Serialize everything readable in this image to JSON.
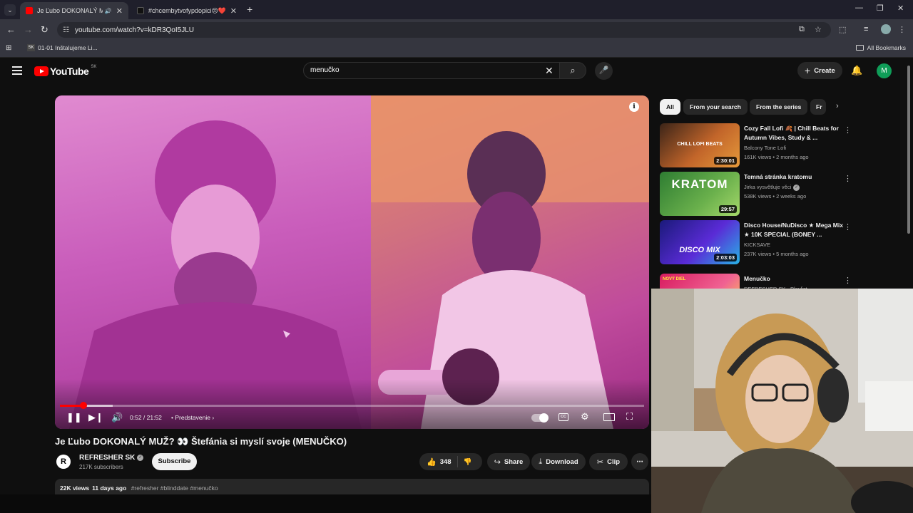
{
  "browser": {
    "tabs": [
      {
        "title": "Je Ľubo DOKONALÝ MUŽ? 👀 Štefánia si myslí svoje (MENUČKO)",
        "active": true
      },
      {
        "title": "#chcembytvofypdopici😒❤️#",
        "active": false
      }
    ],
    "url": "youtube.com/watch?v=kDR3QoI5JLU",
    "bookmarks": [
      {
        "label": "01-01 Inštalujeme Li..."
      }
    ],
    "all_bookmarks_label": "All Bookmarks"
  },
  "youtube": {
    "logo_text": "YouTube",
    "region": "SK",
    "search_value": "menučko",
    "create_label": "Create",
    "avatar_letter": "M"
  },
  "player": {
    "current_time": "0:52",
    "duration": "21:52",
    "time_display": "0:52 / 21:52",
    "chapter": "Predstavenie",
    "progress_fraction": 0.04,
    "buffered_fraction": 0.09,
    "accent": "#ff0000"
  },
  "video": {
    "title": "Je Ľubo DOKONALÝ MUŽ? 👀 Štefánia si myslí svoje (MENUČKO)",
    "channel_name": "REFRESHER SK",
    "subscribers": "217K subscribers",
    "subscribe_label": "Subscribe",
    "likes": "348",
    "share_label": "Share",
    "download_label": "Download",
    "clip_label": "Clip",
    "views": "22K views",
    "age": "11 days ago",
    "tags": "#refresher #blinddate #menučko"
  },
  "sidebar": {
    "chips": [
      "All",
      "From your search",
      "From the series",
      "Fr"
    ],
    "recommendations": [
      {
        "title": "Cozy Fall Lofi 🍂 | Chill Beats for Autumn Vibes, Study & ...",
        "channel": "Balcony Tone Lofi",
        "meta": "161K views • 2 months ago",
        "duration": "2:30:01",
        "thumb_text": "CHILL LOFI BEATS"
      },
      {
        "title": "Temná stránka kratomu",
        "channel": "Jirka vysvětluje věci",
        "meta": "538K views • 2 weeks ago",
        "duration": "29:57",
        "thumb_text": "KRATOM"
      },
      {
        "title": "Disco House/NuDisco ★ Mega Mix ★ 10K SPECIAL (BONEY ...",
        "channel": "KICKSAVE",
        "meta": "237K views • 5 months ago",
        "duration": "2:03:03",
        "thumb_text": "DISCO MIX"
      },
      {
        "title": "Menučko",
        "channel": "REFRESHER SK",
        "meta": "Playlist",
        "duration": "",
        "thumb_text": "NOVÝ DIEL"
      }
    ]
  }
}
